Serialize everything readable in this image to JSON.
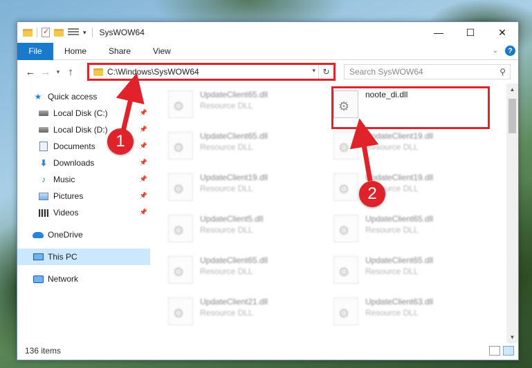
{
  "window": {
    "title": "SysWOW64",
    "controls": {
      "minimize": "—",
      "maximize": "☐",
      "close": "✕"
    }
  },
  "ribbon": {
    "tabs": [
      "File",
      "Home",
      "Share",
      "View"
    ],
    "help": "?",
    "expand": "⌄"
  },
  "address": {
    "path": "C:\\Windows\\SysWOW64",
    "search_placeholder": "Search SysWOW64"
  },
  "sidebar": {
    "quick_access": "Quick access",
    "items": [
      {
        "label": "Local Disk (C:)",
        "icon": "drive-icon"
      },
      {
        "label": "Local Disk (D:)",
        "icon": "drive-icon"
      },
      {
        "label": "Documents",
        "icon": "documents-icon"
      },
      {
        "label": "Downloads",
        "icon": "download-icon"
      },
      {
        "label": "Music",
        "icon": "music-icon"
      },
      {
        "label": "Pictures",
        "icon": "pictures-icon"
      },
      {
        "label": "Videos",
        "icon": "videos-icon"
      }
    ],
    "onedrive": "OneDrive",
    "this_pc": "This PC",
    "network": "Network"
  },
  "files": {
    "left_column": [
      {
        "name": "UpdateClient65.dll",
        "type": "Resource DLL"
      },
      {
        "name": "UpdateClient65.dll",
        "type": "Resource DLL"
      },
      {
        "name": "UpdateClient19.dll",
        "type": "Resource DLL"
      },
      {
        "name": "UpdateClient5.dll",
        "type": "Resource DLL"
      },
      {
        "name": "UpdateClient65.dll",
        "type": "Resource DLL"
      },
      {
        "name": "UpdateClient21.dll",
        "type": "Resource DLL"
      }
    ],
    "right_column": [
      {
        "name": "noote_di.dll",
        "type": ""
      },
      {
        "name": "UpdateClient19.dll",
        "type": "Resource DLL"
      },
      {
        "name": "UpdateClient19.dll",
        "type": "Resource DLL"
      },
      {
        "name": "UpdateClient65.dll",
        "type": "Resource DLL"
      },
      {
        "name": "UpdateClient65.dll",
        "type": "Resource DLL"
      },
      {
        "name": "UpdateClient63.dll",
        "type": "Resource DLL"
      }
    ]
  },
  "status": {
    "item_count": "136 items"
  },
  "annotations": {
    "step1": "1",
    "step2": "2",
    "color": "#e0222b"
  }
}
